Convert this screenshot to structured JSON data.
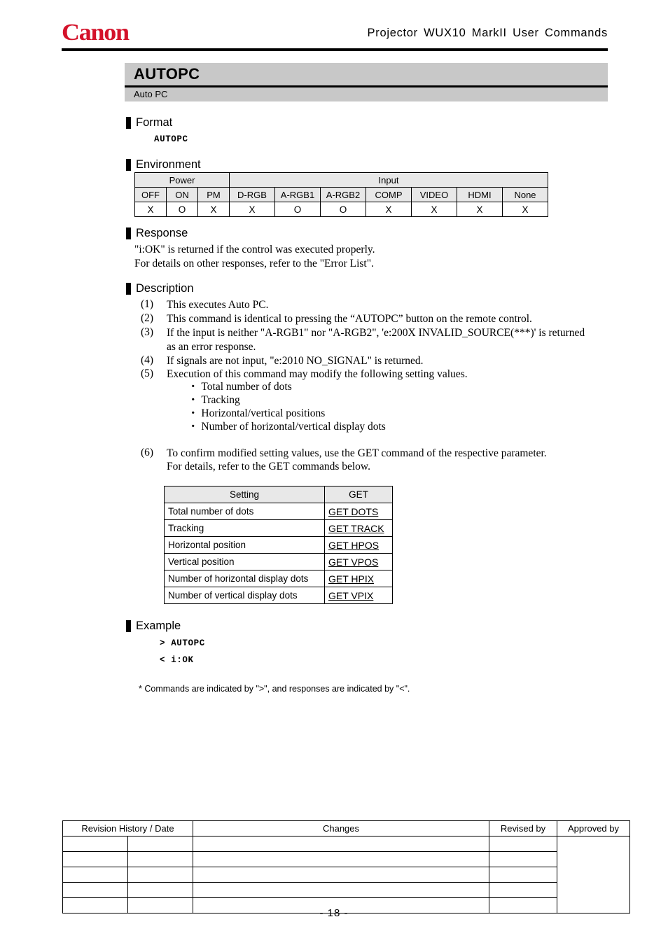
{
  "header": {
    "logo_text": "Canon",
    "logo_color": "#d4122a",
    "title": "Projector  WUX10  MarkII  User  Commands"
  },
  "command": {
    "name": "AUTOPC",
    "subtitle": "Auto PC"
  },
  "sections": {
    "format": {
      "heading": "Format",
      "syntax": "AUTOPC"
    },
    "environment": {
      "heading": "Environment",
      "group_headers": [
        "Power",
        "Input"
      ],
      "columns": [
        "OFF",
        "ON",
        "PM",
        "D-RGB",
        "A-RGB1",
        "A-RGB2",
        "COMP",
        "VIDEO",
        "HDMI",
        "None"
      ],
      "values": [
        "X",
        "O",
        "X",
        "X",
        "O",
        "O",
        "X",
        "X",
        "X",
        "X"
      ]
    },
    "response": {
      "heading": "Response",
      "lines": [
        "\"i:OK\" is returned if the control was executed properly.",
        "For details on other responses, refer to the \"Error List\"."
      ]
    },
    "description": {
      "heading": "Description",
      "items": [
        {
          "num": "(1)",
          "lines": [
            "This executes Auto PC."
          ]
        },
        {
          "num": "(2)",
          "lines": [
            "This command is identical to pressing the “AUTOPC” button on the remote control."
          ]
        },
        {
          "num": "(3)",
          "lines": [
            "If the input is neither \"A-RGB1\" nor \"A-RGB2\", 'e:200X INVALID_SOURCE(***)' is returned",
            "as an error response."
          ]
        },
        {
          "num": "(4)",
          "lines": [
            "If signals are not input, \"e:2010 NO_SIGNAL\" is returned."
          ]
        },
        {
          "num": "(5)",
          "lines": [
            "Execution of this command may modify the following setting values."
          ]
        },
        {
          "num": "(6)",
          "lines": [
            "To confirm modified setting values, use the GET command of the respective parameter.",
            "For details, refer to the GET commands below."
          ]
        }
      ],
      "bullets": [
        "・ Total number of dots",
        "・ Tracking",
        "・ Horizontal/vertical positions",
        "・ Number of horizontal/vertical display dots"
      ]
    },
    "get_table": {
      "headers": [
        "Setting",
        "GET"
      ],
      "rows": [
        {
          "setting": "Total number of dots",
          "command": "GET DOTS"
        },
        {
          "setting": "Tracking",
          "command": "GET TRACK"
        },
        {
          "setting": "Horizontal position",
          "command": "GET HPOS"
        },
        {
          "setting": "Vertical position",
          "command": "GET VPOS"
        },
        {
          "setting": "Number of horizontal display dots",
          "command": "GET HPIX"
        },
        {
          "setting": "Number of vertical display dots",
          "command": "GET VPIX"
        }
      ]
    },
    "example": {
      "heading": "Example",
      "command_line": "> AUTOPC",
      "response_line": "< i:OK",
      "footnote": "* Commands are indicated by \">\", and responses are indicated by \"<\"."
    }
  },
  "revision_table": {
    "headers": [
      "Revision History / Date",
      "Changes",
      "Revised by",
      "Approved by"
    ],
    "rows": [
      {
        "date1": "",
        "date2": "",
        "changes": "",
        "revised_by": ""
      },
      {
        "date1": "",
        "date2": "",
        "changes": "",
        "revised_by": ""
      },
      {
        "date1": "",
        "date2": "",
        "changes": "",
        "revised_by": ""
      },
      {
        "date1": "",
        "date2": "",
        "changes": "",
        "revised_by": ""
      },
      {
        "date1": "",
        "date2": "",
        "changes": "",
        "revised_by": ""
      }
    ],
    "approved_by_value": ""
  },
  "footer": {
    "page_number": "- 18 -"
  }
}
